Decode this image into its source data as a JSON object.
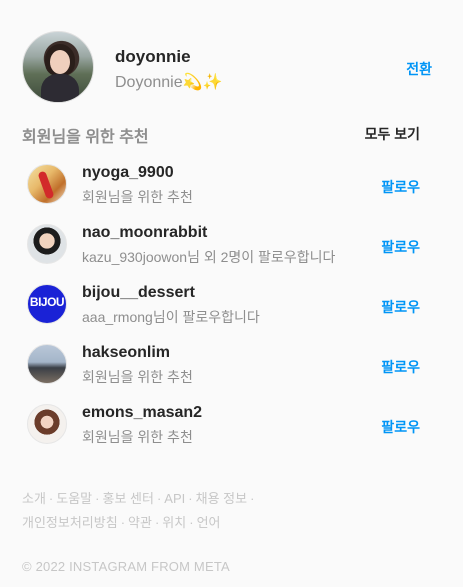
{
  "profile": {
    "username": "doyonnie",
    "full_name": "Doyonnie💫✨",
    "switch_label": "전환"
  },
  "suggestions": {
    "title": "회원님을 위한 추천",
    "see_all": "모두 보기",
    "items": [
      {
        "username": "nyoga_9900",
        "subtitle": "회원님을 위한 추천",
        "follow_label": "팔로우"
      },
      {
        "username": "nao_moonrabbit",
        "subtitle": "kazu_930joowon님 외 2명이 팔로우합니다",
        "follow_label": "팔로우"
      },
      {
        "username": "bijou__dessert",
        "subtitle": "aaa_rmong님이 팔로우합니다",
        "follow_label": "팔로우",
        "avatar_text": "BIJOU"
      },
      {
        "username": "hakseonlim",
        "subtitle": "회원님을 위한 추천",
        "follow_label": "팔로우"
      },
      {
        "username": "emons_masan2",
        "subtitle": "회원님을 위한 추천",
        "follow_label": "팔로우"
      }
    ]
  },
  "footer": {
    "links_line1": [
      "소개",
      "도움말",
      "홍보 센터",
      "API",
      "채용 정보"
    ],
    "links_line2": [
      "개인정보처리방침",
      "약관",
      "위치",
      "언어"
    ],
    "copyright": "© 2022 INSTAGRAM FROM META"
  },
  "colors": {
    "accent": "#0095f6",
    "muted": "#8e8e8e",
    "footer": "#c7c7c7"
  }
}
